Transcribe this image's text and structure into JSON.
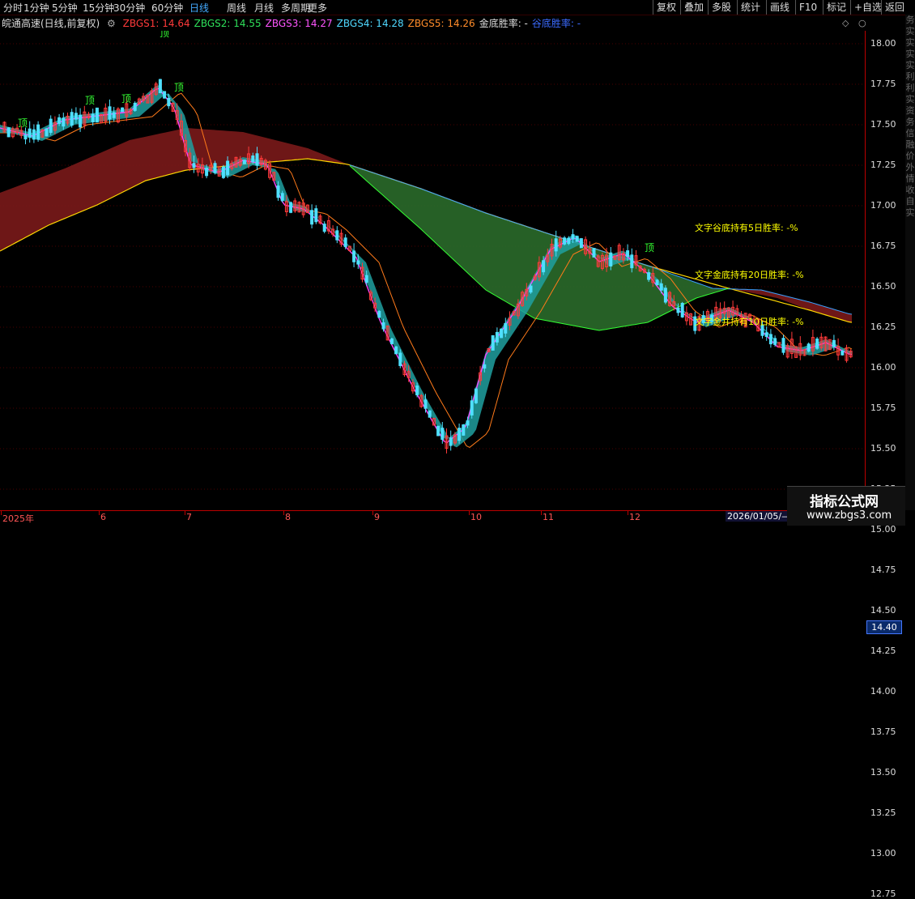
{
  "tabs": [
    "分时",
    "1分钟",
    "5分钟",
    "15分钟",
    "30分钟",
    "60分钟",
    "日线",
    "周线",
    "月线",
    "多周期",
    "更多"
  ],
  "active_tab": "日线",
  "toolbar": [
    "复权",
    "叠加",
    "多股",
    "统计",
    "画线",
    "F10",
    "标记",
    "+自选",
    "返回"
  ],
  "title": "皖通高速(日线,前复权)",
  "legend": [
    {
      "text": "ZBGS1: 14.64",
      "color": "#ff3a3a"
    },
    {
      "text": "ZBGS2: 14.55",
      "color": "#2ee05a"
    },
    {
      "text": "ZBGS3: 14.27",
      "color": "#ff55ff"
    },
    {
      "text": "ZBGS4: 14.28",
      "color": "#4fd8ff"
    },
    {
      "text": "ZBGS5: 14.26",
      "color": "#ff8c2a"
    },
    {
      "text": "金底胜率: -",
      "color": "#dddddd"
    },
    {
      "text": "谷底胜率: -",
      "color": "#3b6bff"
    }
  ],
  "y_ticks": [
    "18.00",
    "17.75",
    "17.50",
    "17.25",
    "17.00",
    "16.75",
    "16.50",
    "16.25",
    "16.00",
    "15.75",
    "15.50",
    "15.25",
    "15.00",
    "14.75",
    "14.50",
    "14.25",
    "14.00",
    "13.75",
    "13.50",
    "13.25",
    "13.00",
    "12.75"
  ],
  "last_price": "14.40",
  "x_labels": [
    {
      "text": "2025年"
    },
    {
      "text": "6"
    },
    {
      "text": "7"
    },
    {
      "text": "8"
    },
    {
      "text": "9"
    },
    {
      "text": "10"
    },
    {
      "text": "11"
    },
    {
      "text": "12"
    }
  ],
  "cursor_date": "2026/01/05/—",
  "top_markers": [
    "顶",
    "顶",
    "顶",
    "顶",
    "顶",
    "顶"
  ],
  "stats": [
    {
      "text": "文字谷底持有5日胜率: -%"
    },
    {
      "text": "文字金底持有20日胜率: -%"
    },
    {
      "text": "文字金井持有10日胜率: -%"
    }
  ],
  "side_text": [
    "务",
    "实",
    "实",
    "实",
    "实",
    "利",
    "利",
    "实",
    "资",
    "务",
    "信",
    "融",
    "价",
    "外",
    "情",
    "收",
    "自",
    "实"
  ],
  "watermark": {
    "title": "指标公式网",
    "url": "www.zbgs3.com"
  }
}
